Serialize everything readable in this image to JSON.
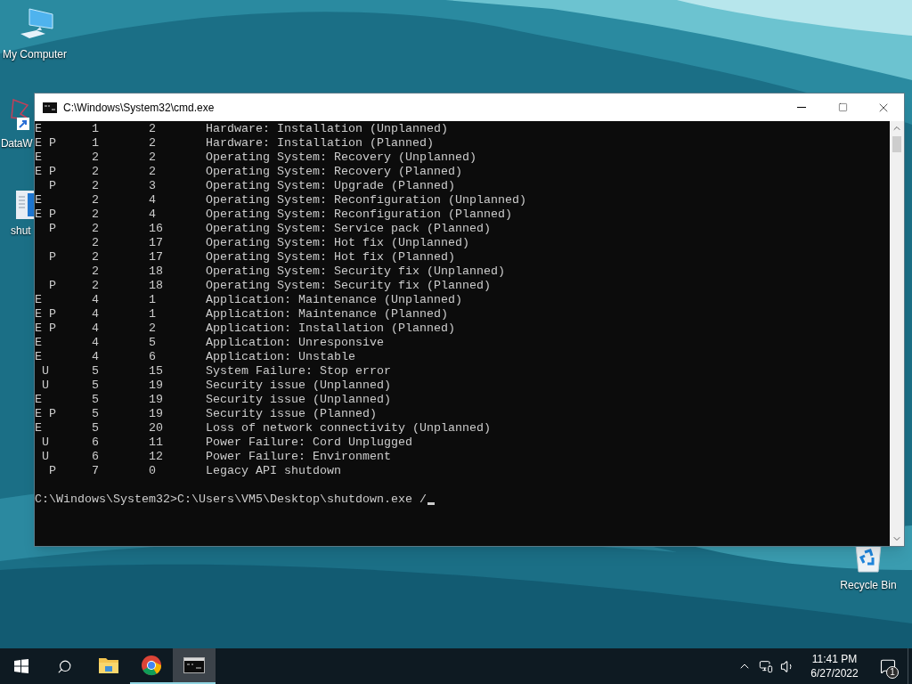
{
  "desktop_icons": [
    {
      "label": "My Computer",
      "kind": "computer"
    },
    {
      "label": "DataW",
      "kind": "shortcut"
    },
    {
      "label": "shut",
      "kind": "document"
    },
    {
      "label": "Recycle Bin",
      "kind": "bin"
    }
  ],
  "console_window": {
    "title": "C:\\Windows\\System32\\cmd.exe",
    "lines": [
      "E       1       2       Hardware: Installation (Unplanned)",
      "E P     1       2       Hardware: Installation (Planned)",
      "E       2       2       Operating System: Recovery (Unplanned)",
      "E P     2       2       Operating System: Recovery (Planned)",
      "  P     2       3       Operating System: Upgrade (Planned)",
      "E       2       4       Operating System: Reconfiguration (Unplanned)",
      "E P     2       4       Operating System: Reconfiguration (Planned)",
      "  P     2       16      Operating System: Service pack (Planned)",
      "        2       17      Operating System: Hot fix (Unplanned)",
      "  P     2       17      Operating System: Hot fix (Planned)",
      "        2       18      Operating System: Security fix (Unplanned)",
      "  P     2       18      Operating System: Security fix (Planned)",
      "E       4       1       Application: Maintenance (Unplanned)",
      "E P     4       1       Application: Maintenance (Planned)",
      "E P     4       2       Application: Installation (Planned)",
      "E       4       5       Application: Unresponsive",
      "E       4       6       Application: Unstable",
      " U      5       15      System Failure: Stop error",
      " U      5       19      Security issue (Unplanned)",
      "E       5       19      Security issue (Unplanned)",
      "E P     5       19      Security issue (Planned)",
      "E       5       20      Loss of network connectivity (Unplanned)",
      " U      6       11      Power Failure: Cord Unplugged",
      " U      6       12      Power Failure: Environment",
      "  P     7       0       Legacy API shutdown"
    ],
    "prompt": "C:\\Windows\\System32>C:\\Users\\VM5\\Desktop\\shutdown.exe /"
  },
  "taskbar": {
    "apps": [
      {
        "kind": "explorer",
        "running": false,
        "selected": false
      },
      {
        "kind": "chrome",
        "running": true,
        "selected": false
      },
      {
        "kind": "console",
        "running": true,
        "selected": true
      }
    ],
    "clock": {
      "time": "11:41 PM",
      "date": "6/27/2022"
    },
    "notification_count": "1"
  }
}
